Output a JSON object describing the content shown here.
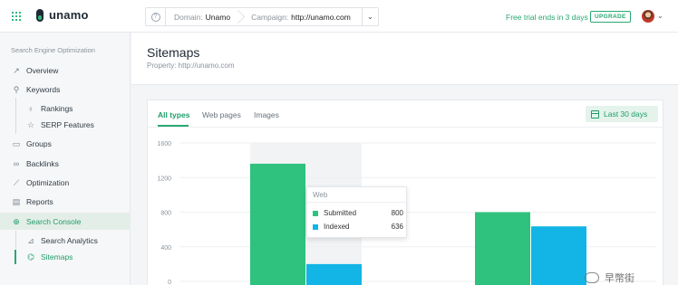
{
  "app": {
    "name": "unamo"
  },
  "filters": {
    "domain_key": "Domain:",
    "domain_value": "Unamo",
    "campaign_key": "Campaign:",
    "campaign_value": "http://unamo.com"
  },
  "account": {
    "trial_text": "Free trial ends in 3 days",
    "upgrade_label": "UPGRADE"
  },
  "sidebar": {
    "heading": "Search Engine Optimization",
    "items": [
      {
        "label": "Overview",
        "icon": "chart-line-icon"
      },
      {
        "label": "Keywords",
        "icon": "key-icon"
      },
      {
        "label": "Rankings",
        "icon": "trophy-icon"
      },
      {
        "label": "SERP Features",
        "icon": "star-icon"
      },
      {
        "label": "Groups",
        "icon": "folder-icon"
      },
      {
        "label": "Backlinks",
        "icon": "link-icon"
      },
      {
        "label": "Optimization",
        "icon": "trend-icon"
      },
      {
        "label": "Reports",
        "icon": "report-icon"
      },
      {
        "label": "Search Console",
        "icon": "search-console-icon"
      },
      {
        "label": "Search Analytics",
        "icon": "analytics-icon"
      },
      {
        "label": "Sitemaps",
        "icon": "sitemap-icon"
      }
    ]
  },
  "page": {
    "title": "Sitemaps",
    "property": "Property: http://unamo.com"
  },
  "tabs": [
    "All types",
    "Web pages",
    "Images"
  ],
  "date_range": {
    "label": "Last 30 days"
  },
  "colors": {
    "submitted": "#2ec27e",
    "indexed": "#12b5e5",
    "accent": "#2aa872"
  },
  "chart_data": {
    "type": "bar",
    "yticks": [
      "1600",
      "1200",
      "800",
      "400",
      "0"
    ],
    "ylim": [
      0,
      1600
    ],
    "series": [
      {
        "name": "Submitted",
        "values": [
          1360,
          800
        ]
      },
      {
        "name": "Indexed",
        "values": [
          200,
          636
        ]
      }
    ]
  },
  "tooltip": {
    "title": "Web",
    "rows": [
      {
        "label": "Submitted",
        "value": "800"
      },
      {
        "label": "Indexed",
        "value": "636"
      }
    ]
  },
  "watermark": {
    "text": "早幣街"
  }
}
